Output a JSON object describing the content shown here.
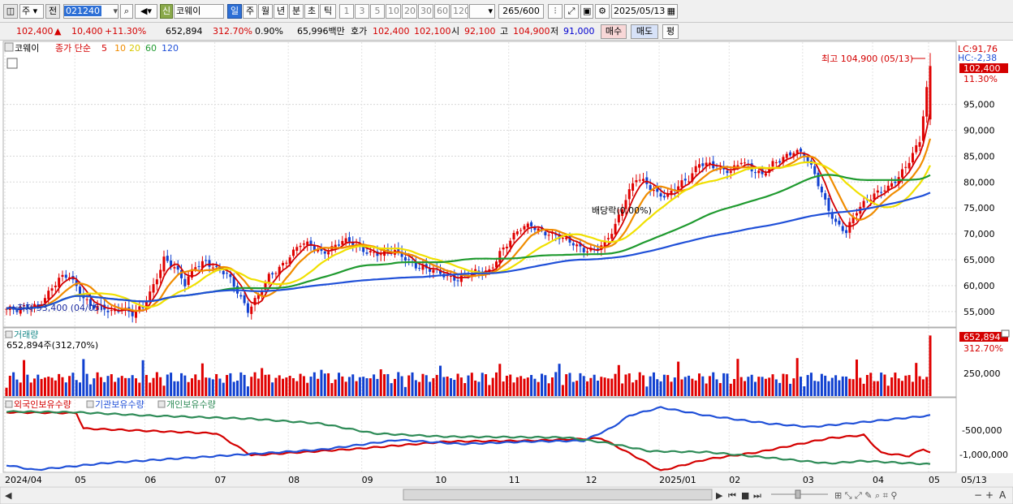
{
  "toolbar": {
    "market": "주",
    "prev_label": "전",
    "code": "021240",
    "stock_name": "코웨이",
    "credit_badge": "신",
    "periods": [
      "일",
      "주",
      "월",
      "년",
      "분",
      "초",
      "틱"
    ],
    "selected_period": "일",
    "minute_options": [
      "1",
      "3",
      "5",
      "10",
      "20",
      "30",
      "60",
      "120"
    ],
    "count": "265",
    "count_max": "/600",
    "date": "2025/05/13"
  },
  "quote": {
    "price": "102,400",
    "change": "10,400",
    "change_pct": "+11.30%",
    "volume": "652,894",
    "volume_ratio": "312.70%",
    "turnover": "0.90%",
    "amount": "65,996백만",
    "bid_label": "호가",
    "ask": "102,400",
    "bid": "102,100",
    "open_label": "시",
    "open": "92,100",
    "high_label": "고",
    "high": "104,900",
    "low_label": "저",
    "low": "91,000",
    "buy_button": "매수",
    "sell_button": "매도",
    "avg_button": "평"
  },
  "chart_data": {
    "type": "candlestick-line-bar",
    "legend": {
      "name": "코웨이",
      "price_series": "종가 단순",
      "ma_periods": [
        "5",
        "10",
        "20",
        "60",
        "120"
      ],
      "ma_colors": [
        "#d40000",
        "#f08c00",
        "#f0e000",
        "#1f9a2f",
        "#2050d8"
      ]
    },
    "price_axis": {
      "ticks": [
        "95,000",
        "90,000",
        "85,000",
        "80,000",
        "75,000",
        "70,000",
        "65,000",
        "60,000",
        "55,000"
      ],
      "tick_values": [
        95000,
        90000,
        85000,
        80000,
        75000,
        70000,
        65000,
        60000,
        55000
      ],
      "range": [
        52000,
        107000
      ],
      "limit_labels": [
        "LC:91,76",
        "HC:-2,38"
      ],
      "current_price_label": "102,400",
      "current_pct_label": "11.30%"
    },
    "annotations": {
      "high": "최고 104,900 (05/13)",
      "low": "최저 53,400 (04/05)",
      "dividend": "배당락(0.00%)"
    },
    "x_axis": {
      "ticks": [
        "2024/04",
        "05",
        "06",
        "07",
        "08",
        "09",
        "10",
        "11",
        "12",
        "2025/01",
        "02",
        "03",
        "04",
        "05",
        "05/13"
      ]
    },
    "price_anchors": [
      [
        0,
        55500
      ],
      [
        3,
        55000
      ],
      [
        6,
        56000
      ],
      [
        9,
        56500
      ],
      [
        12,
        58500
      ],
      [
        15,
        61000
      ],
      [
        18,
        62000
      ],
      [
        21,
        59000
      ],
      [
        24,
        56000
      ],
      [
        27,
        55500
      ],
      [
        30,
        55000
      ],
      [
        33,
        56000
      ],
      [
        36,
        54500
      ],
      [
        39,
        55500
      ],
      [
        42,
        60000
      ],
      [
        45,
        65500
      ],
      [
        48,
        63500
      ],
      [
        51,
        60000
      ],
      [
        54,
        64000
      ],
      [
        57,
        65000
      ],
      [
        60,
        63000
      ],
      [
        63,
        62000
      ],
      [
        66,
        59000
      ],
      [
        69,
        55500
      ],
      [
        72,
        58000
      ],
      [
        75,
        61500
      ],
      [
        78,
        63500
      ],
      [
        81,
        66000
      ],
      [
        84,
        68000
      ],
      [
        87,
        67500
      ],
      [
        90,
        66500
      ],
      [
        93,
        67500
      ],
      [
        96,
        68500
      ],
      [
        99,
        68000
      ],
      [
        102,
        67000
      ],
      [
        105,
        66500
      ],
      [
        108,
        66000
      ],
      [
        111,
        66500
      ],
      [
        114,
        65500
      ],
      [
        117,
        64000
      ],
      [
        120,
        63000
      ],
      [
        123,
        62500
      ],
      [
        126,
        62000
      ],
      [
        129,
        61500
      ],
      [
        132,
        62000
      ],
      [
        135,
        62500
      ],
      [
        138,
        63000
      ],
      [
        141,
        66500
      ],
      [
        144,
        68500
      ],
      [
        147,
        71000
      ],
      [
        150,
        72000
      ],
      [
        153,
        70500
      ],
      [
        156,
        69500
      ],
      [
        159,
        69000
      ],
      [
        162,
        68500
      ],
      [
        165,
        67000
      ],
      [
        168,
        66500
      ],
      [
        171,
        68000
      ],
      [
        174,
        72000
      ],
      [
        177,
        77000
      ],
      [
        180,
        80500
      ],
      [
        183,
        79500
      ],
      [
        186,
        78000
      ],
      [
        189,
        77500
      ],
      [
        192,
        79000
      ],
      [
        195,
        80500
      ],
      [
        198,
        84000
      ],
      [
        201,
        83500
      ],
      [
        204,
        82000
      ],
      [
        207,
        82000
      ],
      [
        210,
        84500
      ],
      [
        213,
        82500
      ],
      [
        216,
        81000
      ],
      [
        219,
        83500
      ],
      [
        222,
        85000
      ],
      [
        225,
        86000
      ],
      [
        228,
        85000
      ],
      [
        231,
        81500
      ],
      [
        234,
        76500
      ],
      [
        237,
        72000
      ],
      [
        240,
        70000
      ],
      [
        243,
        74500
      ],
      [
        246,
        77000
      ],
      [
        249,
        78000
      ],
      [
        252,
        78500
      ],
      [
        255,
        81000
      ],
      [
        258,
        84500
      ],
      [
        261,
        88000
      ],
      [
        264,
        102400
      ]
    ],
    "volume_axis": {
      "ticks": [
        "250,000"
      ],
      "tick_values": [
        250000
      ],
      "current_label": "652,894",
      "current_pct_label": "312.70%",
      "header": "거래량",
      "header_value": "652,894주(312,70%)"
    },
    "holdings": {
      "series": [
        {
          "name": "외국인보유수량",
          "color": "#d40000"
        },
        {
          "name": "기관보유수량",
          "color": "#2050d8"
        },
        {
          "name": "개인보유수량",
          "color": "#2e8b57"
        }
      ],
      "ticks": [
        "-500,000",
        "-1,000,000"
      ],
      "tick_values": [
        -500000,
        -1000000
      ]
    }
  },
  "bottom": {
    "scroll_left": "◀",
    "play": "▶",
    "first": "⏮",
    "stop": "■",
    "last": "⏭",
    "zoom_minus": "−",
    "zoom_plus": "+",
    "font_a": "A"
  }
}
